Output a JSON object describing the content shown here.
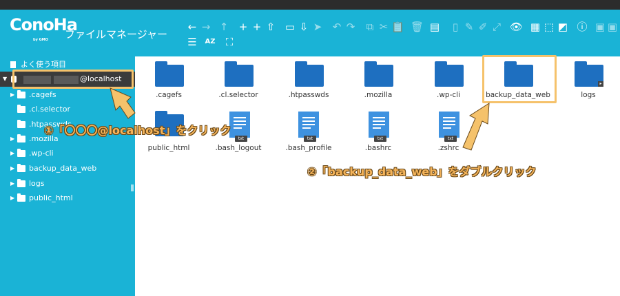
{
  "header": {
    "logo_text": "ConoHa",
    "logo_sub": "by GMO",
    "app_title": "ファイルマネージャー"
  },
  "toolbar": {
    "back": "←",
    "forward": "→",
    "up": "↑",
    "new_folder": "+",
    "new_file": "+",
    "upload": "⇧",
    "open": "▭",
    "download": "⇩",
    "select": "➤",
    "undo": "↶",
    "redo": "↷",
    "copy": "⧉",
    "cut": "✂",
    "paste": "📋",
    "delete": "🗑",
    "duplicate": "▤",
    "view": "👁",
    "select_all": "▦",
    "select_none": "⬚",
    "invert": "◩",
    "info": "ⓘ",
    "list_view": "☰",
    "sort": "AZ",
    "fullscreen": "⛶"
  },
  "sidebar": {
    "favorites": "よく使う項目",
    "root_label": "@localhost",
    "items": [
      {
        "label": ".cagefs"
      },
      {
        "label": ".cl.selector"
      },
      {
        "label": ".htpasswds"
      },
      {
        "label": ".mozilla"
      },
      {
        "label": ".wp-cli"
      },
      {
        "label": "backup_data_web"
      },
      {
        "label": "logs"
      },
      {
        "label": "public_html"
      }
    ]
  },
  "files": [
    {
      "name": ".cagefs",
      "kind": "folder"
    },
    {
      "name": ".cl.selector",
      "kind": "folder"
    },
    {
      "name": ".htpasswds",
      "kind": "folder"
    },
    {
      "name": ".mozilla",
      "kind": "folder"
    },
    {
      "name": ".wp-cli",
      "kind": "folder"
    },
    {
      "name": "backup_data_web",
      "kind": "folder"
    },
    {
      "name": "logs",
      "kind": "folder"
    },
    {
      "name": "public_html",
      "kind": "folder"
    },
    {
      "name": ".bash_logout",
      "kind": "txt"
    },
    {
      "name": ".bash_profile",
      "kind": "txt"
    },
    {
      "name": ".bashrc",
      "kind": "txt"
    },
    {
      "name": ".zshrc",
      "kind": "txt"
    }
  ],
  "file_type_tag": "txt",
  "annotations": {
    "step1": "①「〇〇〇@localhost」をクリック",
    "step2": "②「backup_data_web」をダブルクリック"
  },
  "colors": {
    "header": "#1ab3d6",
    "folder": "#1e6fc0",
    "doc": "#3e92e0",
    "highlight": "#f5c26b"
  }
}
